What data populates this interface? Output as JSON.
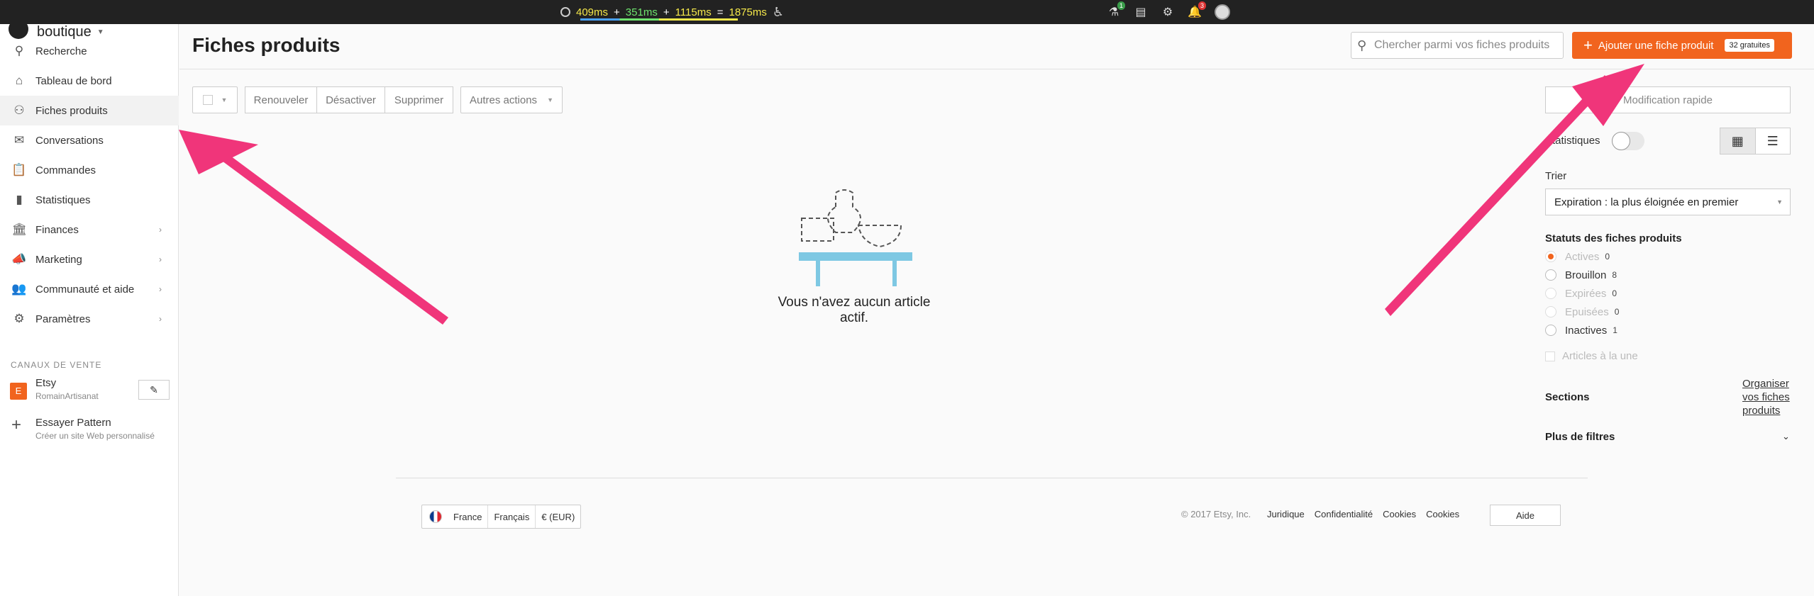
{
  "devbar": {
    "t1": "409ms",
    "t2": "351ms",
    "t3": "1115ms",
    "total": "1875ms",
    "plus": "+",
    "equals": "=",
    "badge_notes": "1",
    "badge_alerts": "3"
  },
  "shop": {
    "name": "boutique"
  },
  "sidebar": {
    "items": [
      {
        "label": "Recherche",
        "icon": "search-icon"
      },
      {
        "label": "Tableau de bord",
        "icon": "home-icon"
      },
      {
        "label": "Fiches produits",
        "icon": "listings-icon",
        "active": true
      },
      {
        "label": "Conversations",
        "icon": "mail-icon"
      },
      {
        "label": "Commandes",
        "icon": "clipboard-icon"
      },
      {
        "label": "Statistiques",
        "icon": "bar-chart-icon"
      },
      {
        "label": "Finances",
        "icon": "bank-icon",
        "chevron": true
      },
      {
        "label": "Marketing",
        "icon": "megaphone-icon",
        "chevron": true
      },
      {
        "label": "Communauté et aide",
        "icon": "community-icon",
        "chevron": true
      },
      {
        "label": "Paramètres",
        "icon": "gear-icon",
        "chevron": true
      }
    ],
    "channels_title": "CANAUX DE VENTE",
    "etsy": {
      "badge": "E",
      "name": "Etsy",
      "shop": "RomainArtisanat"
    },
    "pattern": {
      "name": "Essayer Pattern",
      "sub": "Créer un site Web personnalisé"
    }
  },
  "header": {
    "title": "Fiches produits",
    "search_placeholder": "Chercher parmi vos fiches produits",
    "add_label": "Ajouter une fiche produit",
    "free_badge": "32 gratuites"
  },
  "toolbar": {
    "renew": "Renouveler",
    "deactivate": "Désactiver",
    "delete": "Supprimer",
    "more": "Autres actions"
  },
  "empty": {
    "message": "Vous n'avez aucun article actif."
  },
  "panel": {
    "quick_edit": "Modification rapide",
    "stats_label": "Statistiques",
    "sort_label": "Trier",
    "sort_value": "Expiration : la plus éloignée en premier",
    "status_title": "Statuts des fiches produits",
    "statuses": [
      {
        "label": "Actives",
        "count": "0",
        "checked": true,
        "disabled": true
      },
      {
        "label": "Brouillon",
        "count": "8",
        "checked": false,
        "disabled": false
      },
      {
        "label": "Expirées",
        "count": "0",
        "checked": false,
        "disabled": true
      },
      {
        "label": "Epuisées",
        "count": "0",
        "checked": false,
        "disabled": true
      },
      {
        "label": "Inactives",
        "count": "1",
        "checked": false,
        "disabled": false
      }
    ],
    "featured_label": "Articles à la une",
    "sections_label": "Sections",
    "organize_link": "Organiser vos fiches produits",
    "more_filters": "Plus de filtres"
  },
  "footer": {
    "country": "France",
    "language": "Français",
    "currency": "€ (EUR)",
    "copyright": "© 2017 Etsy, Inc.",
    "links": [
      "Juridique",
      "Confidentialité",
      "Cookies",
      "Cookies"
    ],
    "help": "Aide"
  },
  "colors": {
    "accent": "#f1641e",
    "arrow": "#f0357a",
    "illustration": "#7ec8e3"
  }
}
